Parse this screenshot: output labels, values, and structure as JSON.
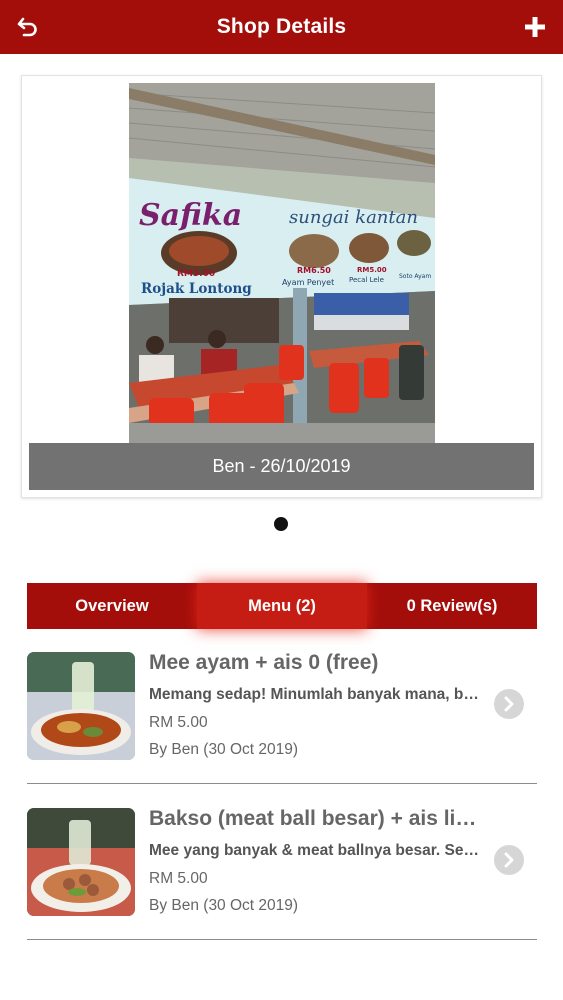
{
  "header": {
    "title": "Shop Details",
    "back_icon": "undo-arrow-icon",
    "add_icon": "plus-icon",
    "color": "#a30e0b"
  },
  "photo": {
    "caption": "Ben - 26/10/2019",
    "banner": {
      "shop_name": "Safika",
      "location": "sungai kantan",
      "dish1_name": "Rojak Lontong",
      "dish1_price": "RM5.00",
      "dish2_name": "Ayam Penyet",
      "dish2_price": "RM6.50",
      "dish3_name": "Pecal Lele",
      "dish3_price": "RM5.00",
      "dish4_name": "Soto Ayam"
    }
  },
  "tabs": {
    "overview": "Overview",
    "menu": "Menu (2)",
    "reviews": "0 Review(s)",
    "active": "menu",
    "active_color": "#c51d13"
  },
  "menu_items": [
    {
      "title": "Mee ayam + ais 0 (free)",
      "description": "Memang sedap! Minumlah banyak mana, boleh",
      "price": "RM 5.00",
      "by": "By Ben (30 Oct 2019)"
    },
    {
      "title": "Bakso (meat ball besar) + ais limau",
      "description": "Mee yang banyak & meat ballnya besar. Sedap",
      "price": "RM 5.00",
      "by": "By Ben (30 Oct 2019)"
    }
  ]
}
